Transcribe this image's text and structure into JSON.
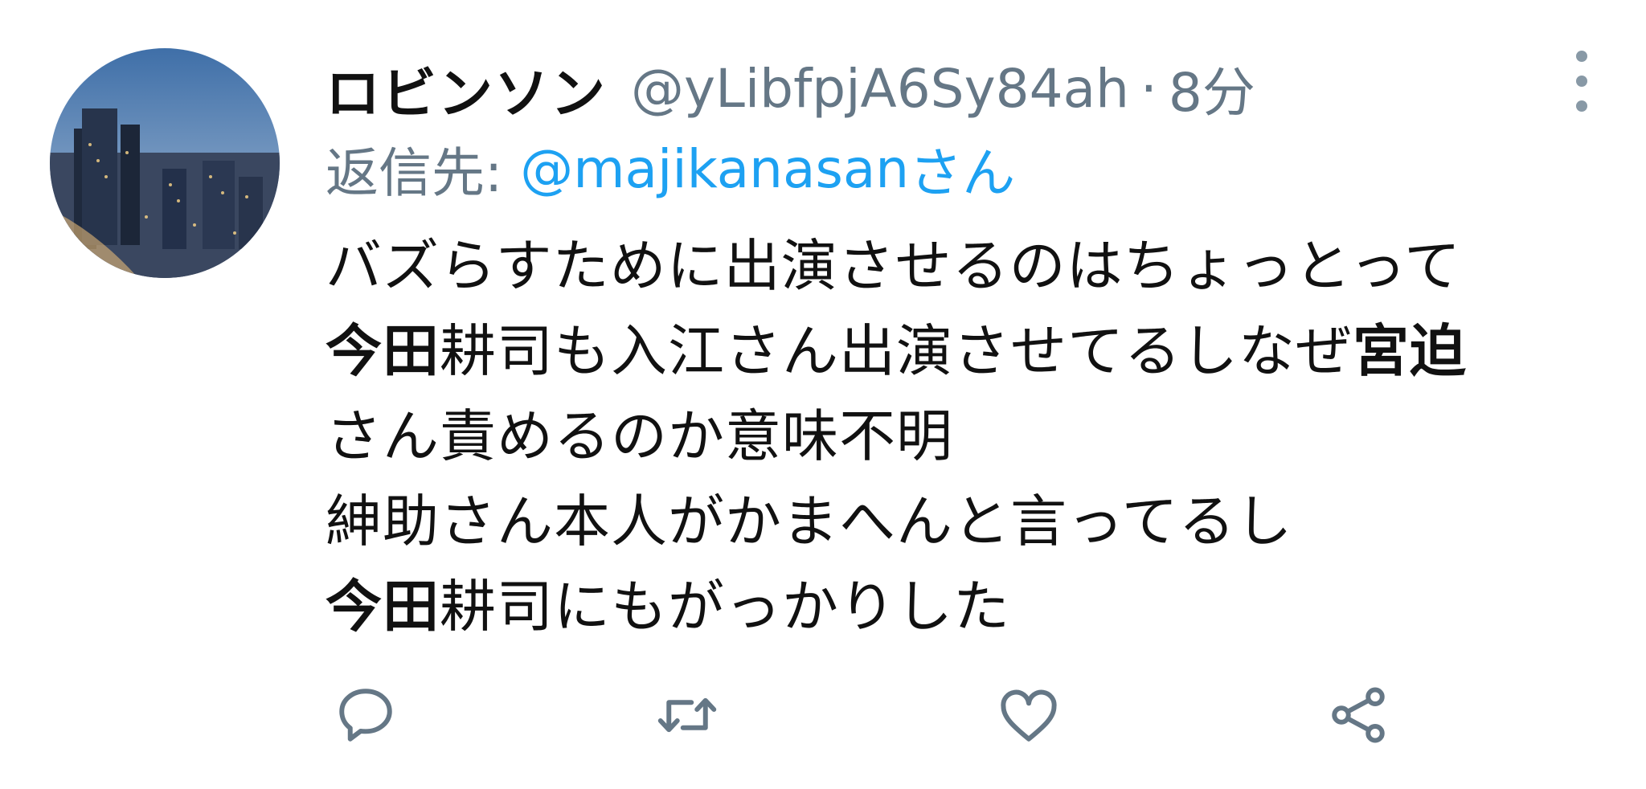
{
  "tweet": {
    "display_name": "ロビンソン",
    "handle": "@yLibfpjA6Sy84ah",
    "separator": "·",
    "timestamp": "8分",
    "reply_label": "返信先:",
    "reply_mention": "@majikanasan",
    "reply_suffix": "さん",
    "body": {
      "line1": "バズらすために出演させるのはちょっとって",
      "line2_kw1": "今田",
      "line2_mid": "耕司も入江さん出演させてるしなぜ",
      "line2_kw2": "宮迫",
      "line3": "さん責めるのか意味不明",
      "line4": "紳助さん本人がかまへんと言ってるし",
      "line5_kw": "今田",
      "line5_rest": "耕司にもがっかりした"
    }
  },
  "icons": {
    "avatar": "city-night-avatar",
    "more": "more-vertical-icon",
    "reply": "reply-icon",
    "retweet": "retweet-icon",
    "like": "heart-icon",
    "share": "share-icon"
  },
  "colors": {
    "text_primary": "#111111",
    "text_secondary": "#657786",
    "link": "#1da1f2",
    "icon": "#657786"
  }
}
